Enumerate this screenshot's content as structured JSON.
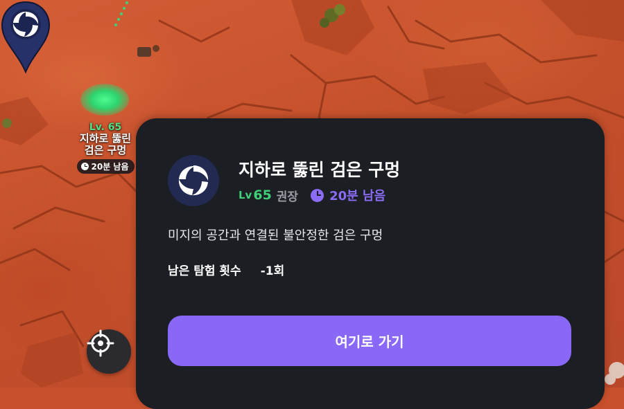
{
  "map": {
    "marker": {
      "level_label": "Lv. 65",
      "name_line1": "지하로 뚫린",
      "name_line2": "검은 구멍",
      "time_left": "20분 남음",
      "pin_icon": "vortex-icon",
      "pin_color": "#26316a",
      "glow_color": "#3be07e"
    },
    "locate_button_icon": "crosshair-icon"
  },
  "panel": {
    "icon": "vortex-icon",
    "title": "지하로 뚫린 검은 구멍",
    "level_prefix": "Lv",
    "level": "65",
    "recommend": "권장",
    "time_left": "20분 남음",
    "description": "미지의 공간과 연결된 불안정한 검은 구멍",
    "remaining_label": "남은 탐험 횟수",
    "remaining_value": "-1회",
    "go_button": "여기로 가기",
    "accent_color": "#8a68f7",
    "level_color": "#3ecf78"
  }
}
